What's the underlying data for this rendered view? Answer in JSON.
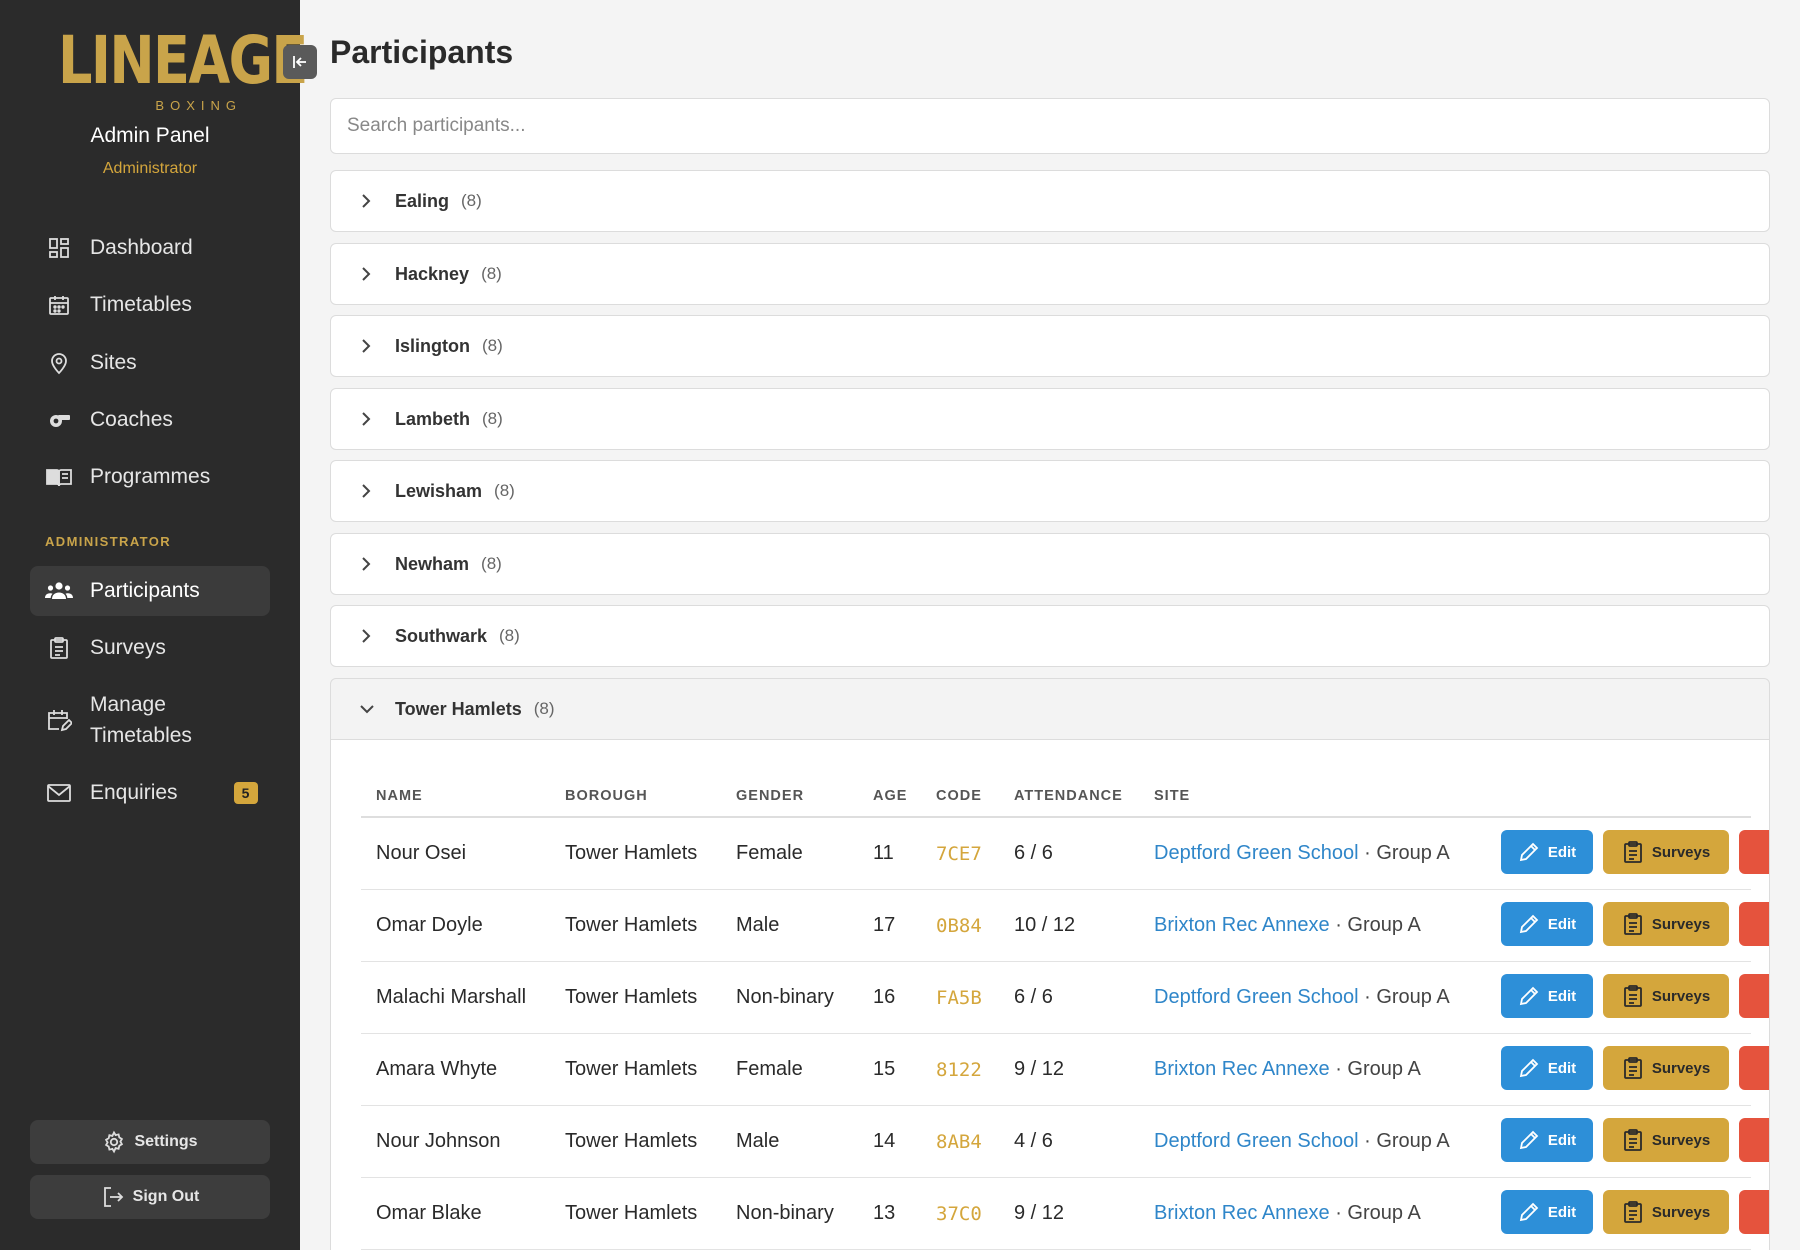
{
  "brand": {
    "logo_word": "LINEAGE",
    "logo_sub": "BOXING",
    "panel_title": "Admin Panel",
    "role": "Administrator"
  },
  "nav": {
    "items": [
      {
        "label": "Dashboard",
        "icon": "dashboard-icon"
      },
      {
        "label": "Timetables",
        "icon": "calendar-icon"
      },
      {
        "label": "Sites",
        "icon": "map-pin-icon"
      },
      {
        "label": "Coaches",
        "icon": "whistle-icon"
      },
      {
        "label": "Programmes",
        "icon": "book-icon"
      }
    ],
    "section_label": "ADMINISTRATOR",
    "admin_items": [
      {
        "label": "Participants",
        "icon": "users-icon",
        "active": true
      },
      {
        "label": "Surveys",
        "icon": "clipboard-icon"
      },
      {
        "label": "Manage\nTimetables",
        "icon": "calendar-edit-icon"
      },
      {
        "label": "Enquiries",
        "icon": "mail-icon",
        "badge": "5"
      }
    ],
    "settings_label": "Settings",
    "signout_label": "Sign Out"
  },
  "main": {
    "title": "Participants",
    "search_placeholder": "Search participants...",
    "groups": [
      {
        "name": "Ealing",
        "count": "(8)"
      },
      {
        "name": "Hackney",
        "count": "(8)"
      },
      {
        "name": "Islington",
        "count": "(8)"
      },
      {
        "name": "Lambeth",
        "count": "(8)"
      },
      {
        "name": "Lewisham",
        "count": "(8)"
      },
      {
        "name": "Newham",
        "count": "(8)"
      },
      {
        "name": "Southwark",
        "count": "(8)"
      },
      {
        "name": "Tower Hamlets",
        "count": "(8)",
        "expanded": true
      }
    ],
    "table": {
      "headers": [
        "NAME",
        "BOROUGH",
        "GENDER",
        "AGE",
        "CODE",
        "ATTENDANCE",
        "SITE"
      ],
      "edit_label": "Edit",
      "surveys_label": "Surveys",
      "rows": [
        {
          "name": "Nour Osei",
          "borough": "Tower Hamlets",
          "gender": "Female",
          "age": "11",
          "code": "7CE7",
          "attendance": "6 / 6",
          "site": "Deptford Green School",
          "group": " · Group A"
        },
        {
          "name": "Omar Doyle",
          "borough": "Tower Hamlets",
          "gender": "Male",
          "age": "17",
          "code": "0B84",
          "attendance": "10 / 12",
          "site": "Brixton Rec Annexe",
          "group": " · Group A"
        },
        {
          "name": "Malachi Marshall",
          "borough": "Tower Hamlets",
          "gender": "Non-binary",
          "age": "16",
          "code": "FA5B",
          "attendance": "6 / 6",
          "site": "Deptford Green School",
          "group": " · Group A"
        },
        {
          "name": "Amara Whyte",
          "borough": "Tower Hamlets",
          "gender": "Female",
          "age": "15",
          "code": "8122",
          "attendance": "9 / 12",
          "site": "Brixton Rec Annexe",
          "group": " · Group A"
        },
        {
          "name": "Nour Johnson",
          "borough": "Tower Hamlets",
          "gender": "Male",
          "age": "14",
          "code": "8AB4",
          "attendance": "4 / 6",
          "site": "Deptford Green School",
          "group": " · Group A"
        },
        {
          "name": "Omar Blake",
          "borough": "Tower Hamlets",
          "gender": "Non-binary",
          "age": "13",
          "code": "37C0",
          "attendance": "9 / 12",
          "site": "Brixton Rec Annexe",
          "group": " · Group A"
        }
      ]
    }
  },
  "colors": {
    "sidebar": "#2b2b2b",
    "accent_gold": "#d4a63c",
    "edit_blue": "#2d8fd8",
    "link_blue": "#2f86c9",
    "delete_red": "#e5533d"
  }
}
